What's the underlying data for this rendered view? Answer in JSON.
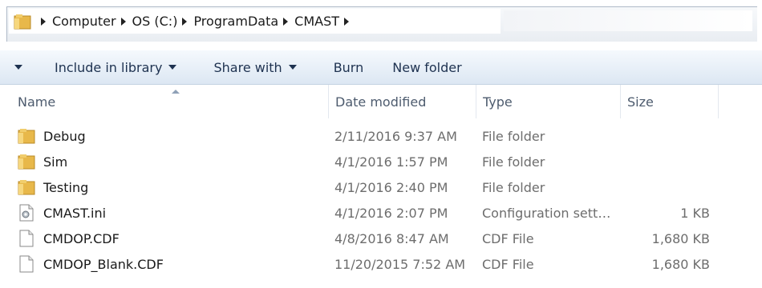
{
  "address": {
    "crumbs": [
      "Computer",
      "OS (C:)",
      "ProgramData",
      "CMAST"
    ]
  },
  "toolbar": {
    "include_label": "Include in library",
    "share_label": "Share with",
    "burn_label": "Burn",
    "new_folder_label": "New folder"
  },
  "columns": {
    "name": "Name",
    "date": "Date modified",
    "type": "Type",
    "size": "Size"
  },
  "files": [
    {
      "name": "Debug",
      "date": "2/11/2016 9:37 AM",
      "type": "File folder",
      "size": "",
      "icon": "folder-icon"
    },
    {
      "name": "Sim",
      "date": "4/1/2016 1:57 PM",
      "type": "File folder",
      "size": "",
      "icon": "folder-icon"
    },
    {
      "name": "Testing",
      "date": "4/1/2016 2:40 PM",
      "type": "File folder",
      "size": "",
      "icon": "folder-icon"
    },
    {
      "name": "CMAST.ini",
      "date": "4/1/2016 2:07 PM",
      "type": "Configuration sett…",
      "size": "1 KB",
      "icon": "config-file-icon"
    },
    {
      "name": "CMDOP.CDF",
      "date": "4/8/2016 8:47 AM",
      "type": "CDF File",
      "size": "1,680 KB",
      "icon": "file-icon"
    },
    {
      "name": "CMDOP_Blank.CDF",
      "date": "11/20/2015 7:52 AM",
      "type": "CDF File",
      "size": "1,680 KB",
      "icon": "file-icon"
    }
  ],
  "colors": {
    "folder": "#e8b84a",
    "toolbar_top": "#f5f9fd",
    "toolbar_bottom": "#dce7f3"
  }
}
